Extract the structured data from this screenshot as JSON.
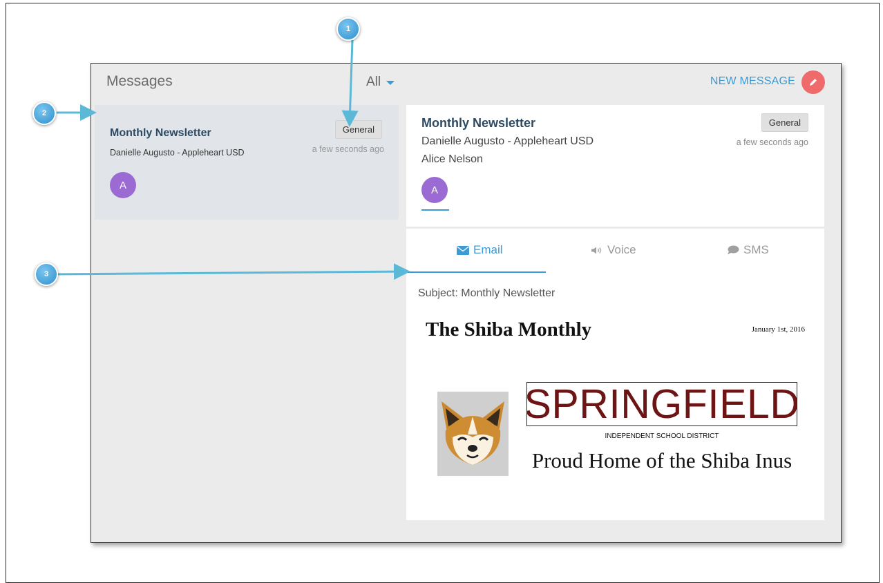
{
  "header": {
    "title": "Messages",
    "filter_label": "All",
    "new_message_label": "NEW MESSAGE"
  },
  "message_list": [
    {
      "title": "Monthly Newsletter",
      "sender": "Danielle Augusto - Appleheart USD",
      "badge": "General",
      "time": "a few seconds ago",
      "avatar_initial": "A"
    }
  ],
  "detail": {
    "title": "Monthly Newsletter",
    "sender": "Danielle Augusto - Appleheart USD",
    "recipient": "Alice Nelson",
    "badge": "General",
    "time": "a few seconds ago",
    "avatar_initial": "A",
    "tabs": [
      {
        "label": "Email",
        "icon": "envelope-icon",
        "active": true
      },
      {
        "label": "Voice",
        "icon": "speaker-icon",
        "active": false
      },
      {
        "label": "SMS",
        "icon": "chat-bubble-icon",
        "active": false
      }
    ],
    "subject": "Subject: Monthly Newsletter",
    "newsletter": {
      "title": "The Shiba Monthly",
      "date": "January 1st, 2016",
      "logo_text": "SPRINGFIELD",
      "district": "INDEPENDENT SCHOOL DISTRICT",
      "tagline": "Proud Home of the Shiba Inus"
    }
  },
  "callouts": [
    "1",
    "2",
    "3"
  ],
  "colors": {
    "accent": "#3a9bd6",
    "fab": "#ef6a6a",
    "avatar": "#9b6bd3",
    "heading": "#2d4a63",
    "logo": "#6d1515"
  }
}
